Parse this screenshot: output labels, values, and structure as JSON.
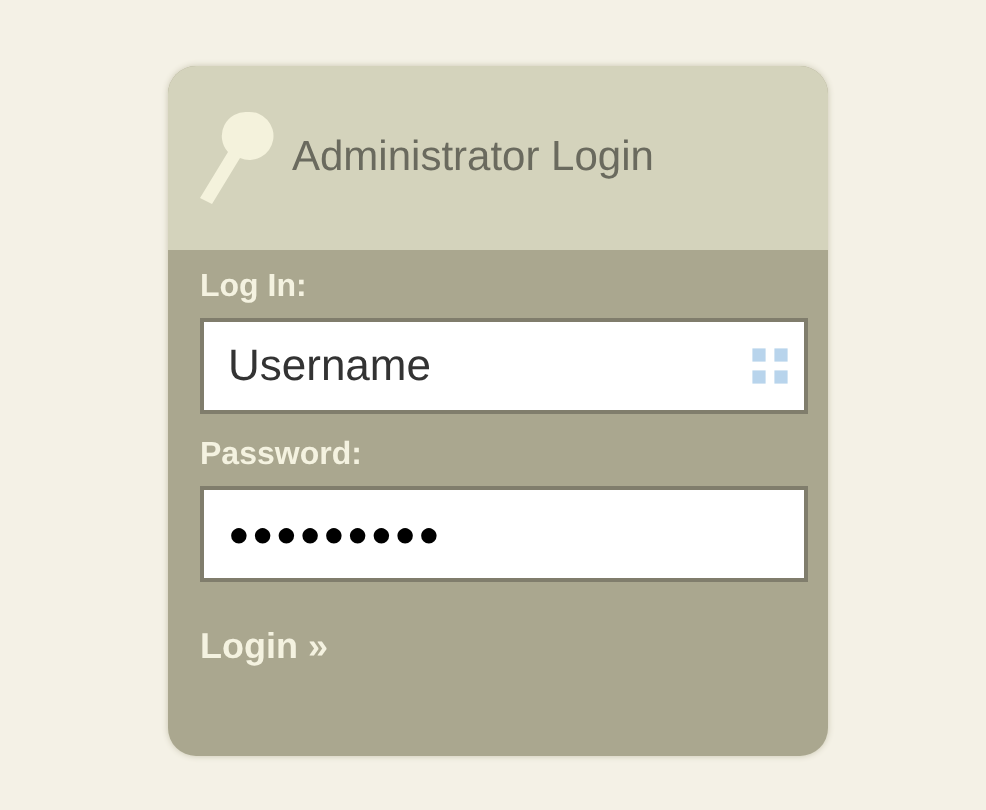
{
  "panel": {
    "title": "Administrator Login"
  },
  "fields": [
    {
      "label": "Log In:",
      "value": "Username",
      "kind": "text"
    },
    {
      "label": "Password:",
      "value": "●●●●●●●●●",
      "kind": "password"
    }
  ],
  "submit": {
    "label": "Login",
    "arrow": "»"
  }
}
